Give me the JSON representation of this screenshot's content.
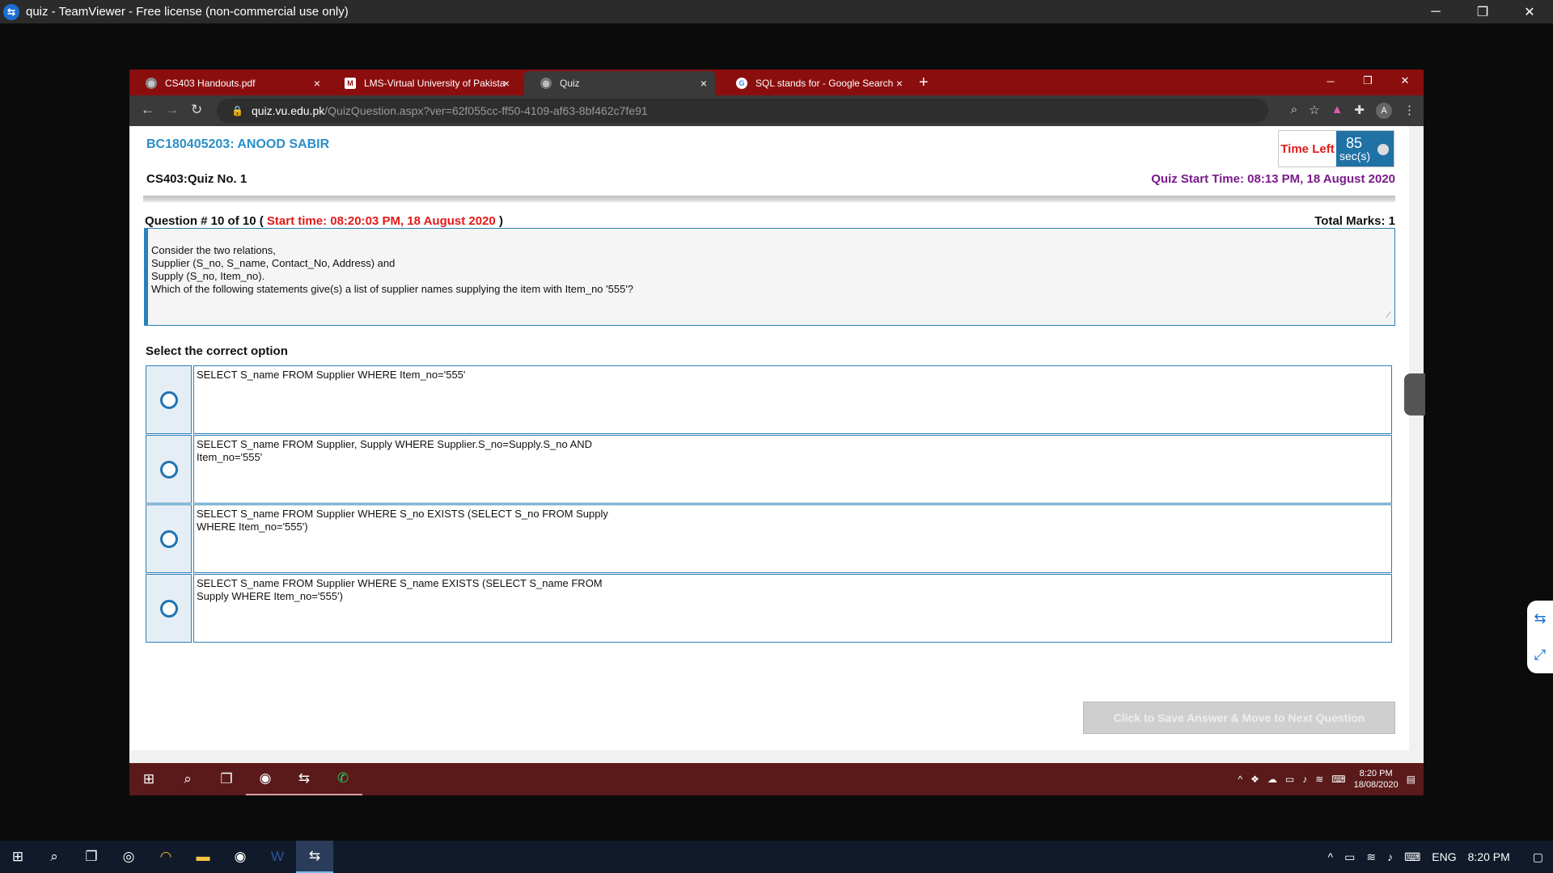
{
  "teamviewer": {
    "title": "quiz - TeamViewer - Free license (non-commercial use only)",
    "minimize": "─",
    "restore": "❐",
    "close": "✕"
  },
  "browser": {
    "tabs": [
      {
        "label": "CS403 Handouts.pdf",
        "icon": "globe-icon"
      },
      {
        "label": "LMS-Virtual University of Pakista",
        "icon": "lms-icon"
      },
      {
        "label": "Quiz",
        "icon": "globe-icon"
      },
      {
        "label": "SQL stands for - Google Search",
        "icon": "google-icon"
      }
    ],
    "tab_close": "×",
    "new_tab": "+",
    "url_host": "quiz.vu.edu.pk",
    "url_path": "/QuizQuestion.aspx?ver=62f055cc-ff50-4109-af63-8bf462c7fe91",
    "avatar": "A"
  },
  "quiz": {
    "student": "BC180405203: ANOOD SABIR",
    "time_left_label": "Time Left",
    "time_value": "85",
    "time_unit": "sec(s)",
    "quiz_name": "CS403:Quiz No. 1",
    "quiz_start": "Quiz Start Time: 08:13 PM, 18 August 2020",
    "question_prefix": "Question # 10 of 10 (",
    "question_start": " Start time: 08:20:03 PM, 18 August 2020 ",
    "question_suffix": ")",
    "total_marks": "Total Marks: 1",
    "question_text": "Consider the two relations,\nSupplier (S_no, S_name, Contact_No, Address) and\nSupply (S_no, Item_no).\nWhich of the following statements give(s) a list of supplier names supplying the item with Item_no '555'?",
    "select_label": "Select the correct option",
    "options": [
      "SELECT S_name FROM Supplier WHERE Item_no='555'",
      "SELECT S_name FROM Supplier, Supply WHERE Supplier.S_no=Supply.S_no AND\nItem_no='555'",
      "SELECT S_name FROM Supplier WHERE S_no EXISTS (SELECT S_no FROM Supply\nWHERE Item_no='555')",
      "SELECT S_name FROM Supplier WHERE S_name EXISTS (SELECT S_name FROM\nSupply WHERE Item_no='555')"
    ],
    "save_button": "Click to Save Answer & Move to Next Question"
  },
  "remote_taskbar": {
    "clock_time": "8:20 PM",
    "clock_date": "18/08/2020"
  },
  "local_taskbar": {
    "lang": "ENG",
    "time": "8:20 PM"
  }
}
